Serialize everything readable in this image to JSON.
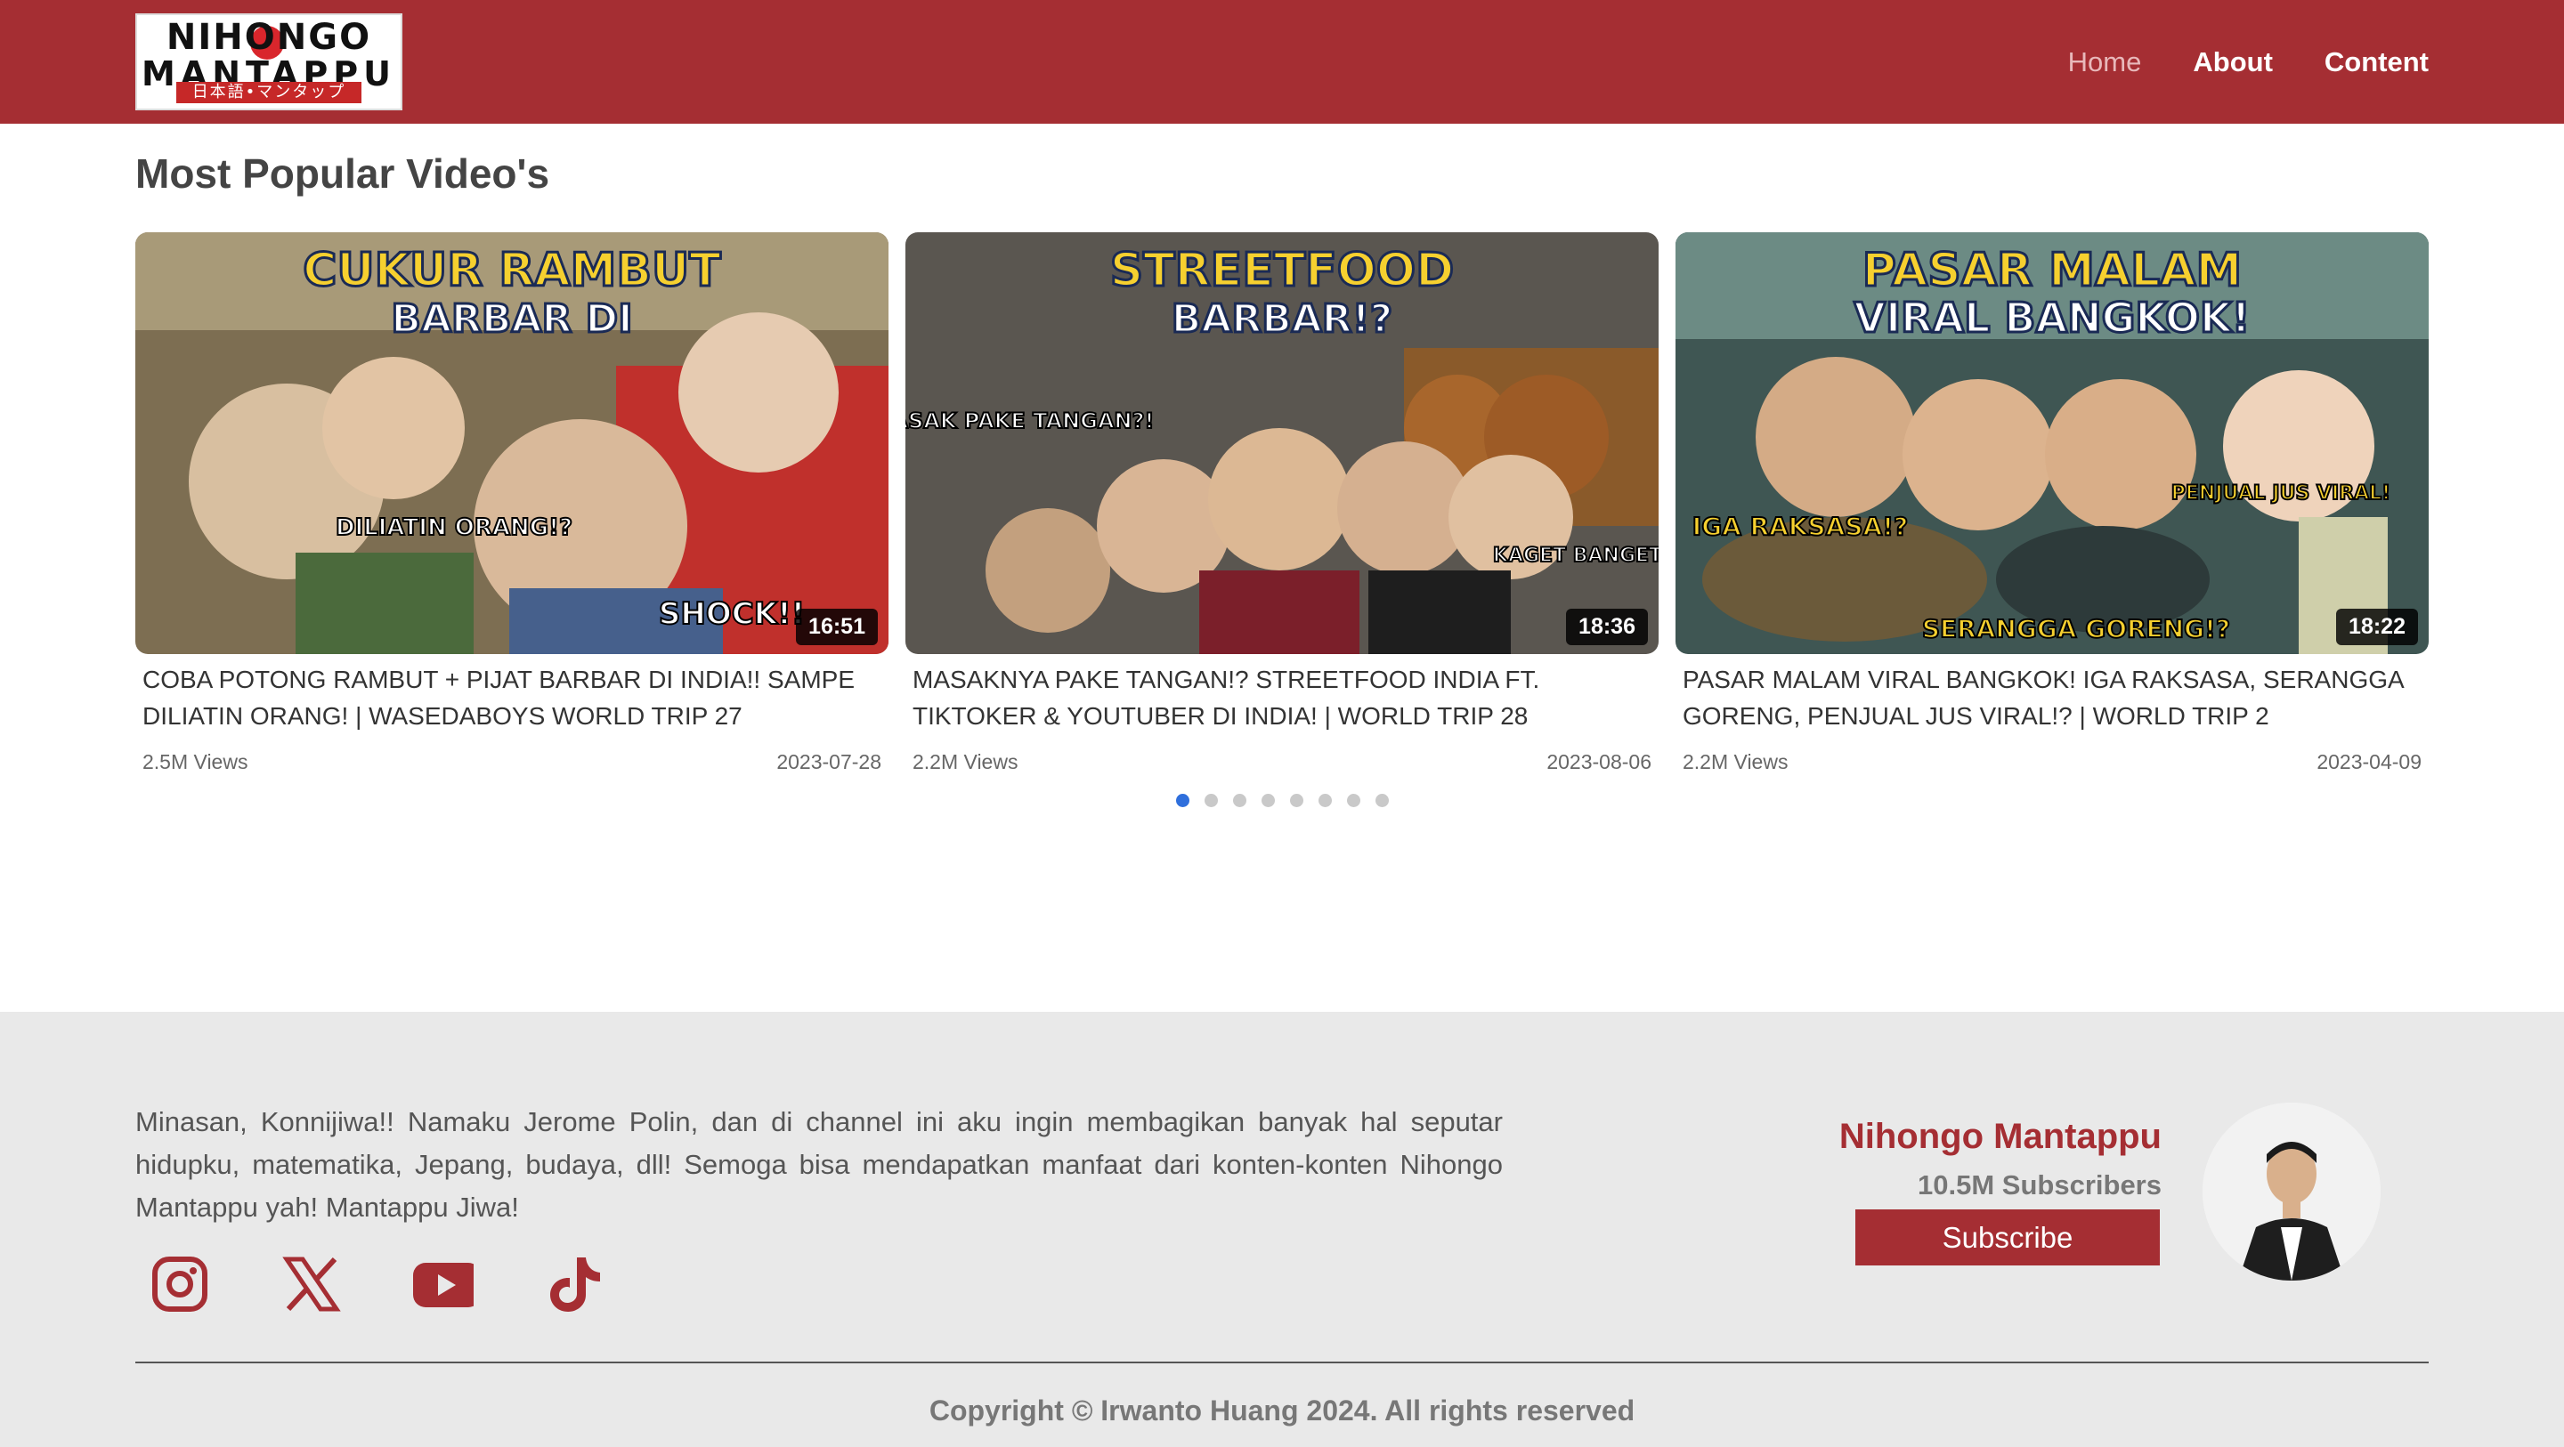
{
  "header": {
    "logo": {
      "line1": "NIHONGO",
      "line2": "MANTAPPU",
      "sub": "日本語•マンタップ"
    },
    "nav": [
      {
        "label": "Home",
        "active": true
      },
      {
        "label": "About",
        "active": false
      },
      {
        "label": "Content",
        "active": false
      }
    ]
  },
  "main": {
    "section_title": "Most Popular Video's",
    "videos": [
      {
        "title": "Coba Potong Rambut + Pijat Barbar di India!! Sampe Diliatin Orang! | WasedaBoys World Trip 27",
        "views": "2.5M Views",
        "date": "2023-07-28",
        "duration": "16:51",
        "thumb_headline_1": "CUKUR RAMBUT",
        "thumb_headline_2": "BARBAR DI",
        "thumb_caption": "DILIATIN ORANG!?",
        "thumb_caption_2": "SHOCK!!",
        "thumb_colors": {
          "bg": "#8a7a5a",
          "accent": "#f6d02f"
        }
      },
      {
        "title": "Masaknya Pake Tangan!? Streetfood India ft. TikToker & YouTuber di India! | World Trip 28",
        "views": "2.2M Views",
        "date": "2023-08-06",
        "duration": "18:36",
        "thumb_headline_1": "STREETFOOD",
        "thumb_headline_2": "BARBAR!?",
        "thumb_caption": "MASAK PAKE TANGAN?!",
        "thumb_caption_2": "KAGET BANGET!",
        "thumb_colors": {
          "bg": "#5d5a55",
          "accent": "#f6d02f"
        }
      },
      {
        "title": "Pasar Malam Viral Bangkok! Iga Raksasa, Serangga Goreng, Penjual Jus Viral!? | World Trip 2",
        "views": "2.2M Views",
        "date": "2023-04-09",
        "duration": "18:22",
        "thumb_headline_1": "PASAR MALAM",
        "thumb_headline_2": "VIRAL BANGKOK!",
        "thumb_caption": "IGA RAKSASA!?",
        "thumb_caption_2": "SERANGGA GORENG!?",
        "thumb_caption_3": "PENJUAL JUS VIRAL!",
        "thumb_colors": {
          "bg": "#3e5a57",
          "accent": "#f6d02f"
        }
      }
    ],
    "pagination": {
      "total": 8,
      "active_index": 0
    }
  },
  "footer": {
    "about": "Minasan, Konnijiwa!! Namaku Jerome Polin, dan di channel ini aku ingin membagikan banyak hal seputar hidupku, matematika, Jepang, budaya, dll! Semoga bisa mendapatkan manfaat dari konten-konten Nihongo Mantappu yah! Mantappu Jiwa!",
    "socials": [
      "instagram-icon",
      "x-icon",
      "youtube-icon",
      "tiktok-icon"
    ],
    "profile": {
      "name": "Nihongo Mantappu",
      "subscribers": "10.5M Subscribers",
      "subscribe_label": "Subscribe"
    },
    "copyright": "Copyright © Irwanto Huang 2024. All rights reserved"
  },
  "colors": {
    "brand": "#a52e33",
    "footer_bg": "#e9e9e9",
    "dot_active": "#2f6fdc"
  }
}
